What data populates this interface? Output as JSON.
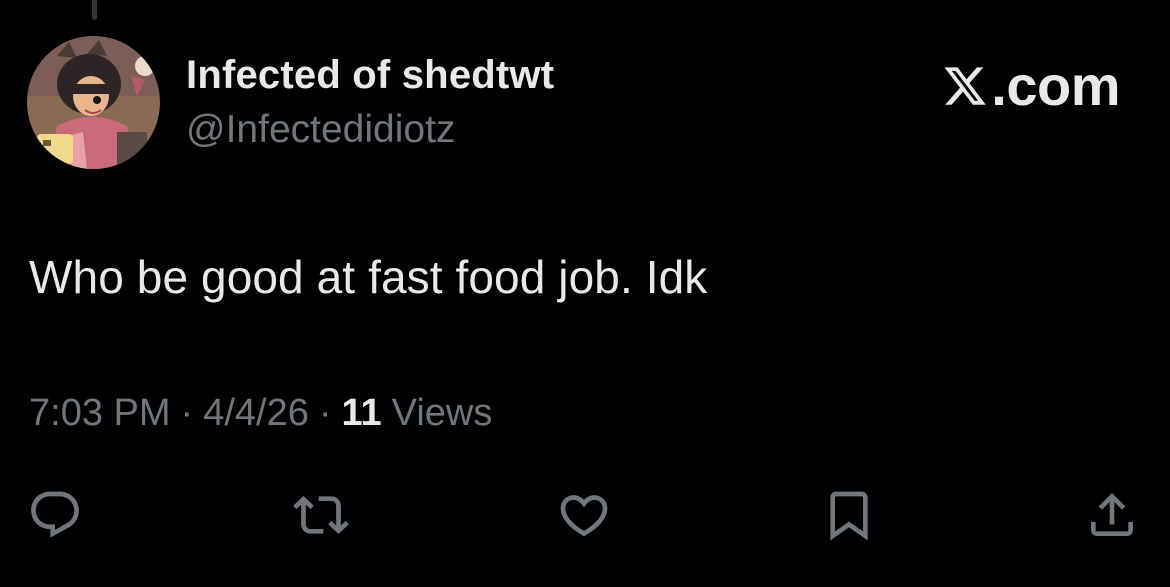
{
  "tweet": {
    "author": {
      "display_name": "Infected of shedtwt",
      "handle": "@Infectedidiotz"
    },
    "brand": {
      "text": ".com",
      "logo_icon": "x-logo-icon"
    },
    "text": "Who be good at fast food job. Idk",
    "meta": {
      "time": "7:03 PM",
      "separator": "·",
      "date": "4/4/26",
      "views_count": "11",
      "views_label": "Views"
    },
    "actions": [
      {
        "name": "reply",
        "icon": "reply-bubble-icon"
      },
      {
        "name": "retweet",
        "icon": "retweet-arrows-icon"
      },
      {
        "name": "like",
        "icon": "heart-icon"
      },
      {
        "name": "bookmark",
        "icon": "bookmark-icon"
      },
      {
        "name": "share",
        "icon": "share-upload-icon"
      }
    ],
    "colors": {
      "background": "#000000",
      "primary_text": "#e7e9ea",
      "secondary_text": "#71767b"
    }
  }
}
